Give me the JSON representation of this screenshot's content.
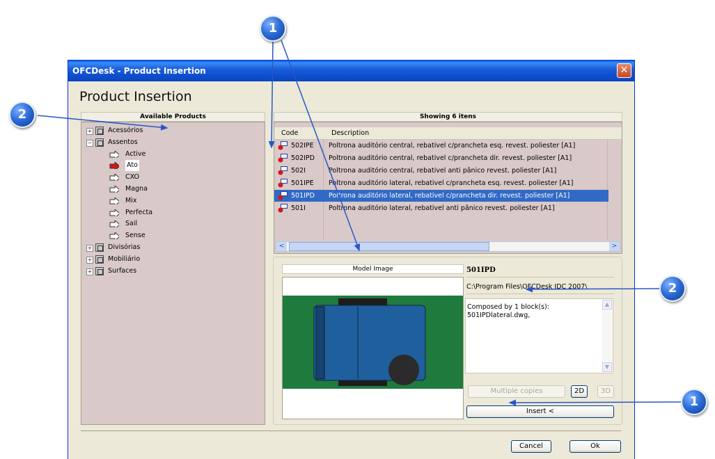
{
  "window": {
    "title": "OFCDesk - Product Insertion",
    "close_glyph": "✕",
    "heading": "Product Insertion"
  },
  "left_panel": {
    "header": "Available Products",
    "tree": [
      {
        "label": "Acessórios",
        "expander": "+"
      },
      {
        "label": "Assentos",
        "expander": "−"
      },
      {
        "label": "Active"
      },
      {
        "label": "Ato"
      },
      {
        "label": "CXO"
      },
      {
        "label": "Magna"
      },
      {
        "label": "Mix"
      },
      {
        "label": "Perfecta"
      },
      {
        "label": "Sail"
      },
      {
        "label": "Sense"
      },
      {
        "label": "Divisórias",
        "expander": "+"
      },
      {
        "label": "Mobiliário",
        "expander": "+"
      },
      {
        "label": "Surfaces",
        "expander": "+"
      }
    ]
  },
  "right_panel": {
    "header": "Showing 6 itens",
    "columns": {
      "code": "Code",
      "description": "Description"
    },
    "rows": [
      {
        "code": "502IPE",
        "description": "Poltrona auditório central, rebativel c/prancheta esq. revest. poliester [A1]"
      },
      {
        "code": "502IPD",
        "description": "Poltrona auditório central, rebativel c/prancheta dir. revest. poliester [A1]"
      },
      {
        "code": "502I",
        "description": "Poltrona auditório central, rebativel anti pânico revest. poliester [A1]"
      },
      {
        "code": "501IPE",
        "description": "Poltrona auditório lateral, rebativel c/prancheta esq. revest. poliester [A1]"
      },
      {
        "code": "501IPD",
        "description": "Poltrona auditório lateral, rebativel c/prancheta dir. revest. poliester [A1]"
      },
      {
        "code": "501I",
        "description": "Poltrona auditório lateral, rebativel anti pânico revest. poliester [A1]"
      }
    ],
    "selected_row": 4,
    "scroll_left": "<",
    "scroll_right": ">"
  },
  "details": {
    "model_image_label": "Model Image",
    "product_code": "501IPD",
    "path": "C:\\Program Files\\OFCDesk IDC 2007\\",
    "composed_line1": "Composed by 1 block(s):",
    "composed_line2": "501IPDlateral.dwg,",
    "multiple_copies": "Multiple copies",
    "view_2d": "2D",
    "view_3d": "3D",
    "insert": "Insert <"
  },
  "footer": {
    "cancel": "Cancel",
    "ok": "Ok"
  },
  "callouts": {
    "top": "1",
    "left": "2",
    "right_mid": "2",
    "right_bottom": "1"
  },
  "colors": {
    "panel_bg": "#d9c9c9",
    "selection": "#316ac5",
    "model_green": "#1f7a3e",
    "model_blue": "#1f5f9e",
    "callout_blue": "#2f6fd8",
    "arrow_blue": "#2a56c6"
  }
}
